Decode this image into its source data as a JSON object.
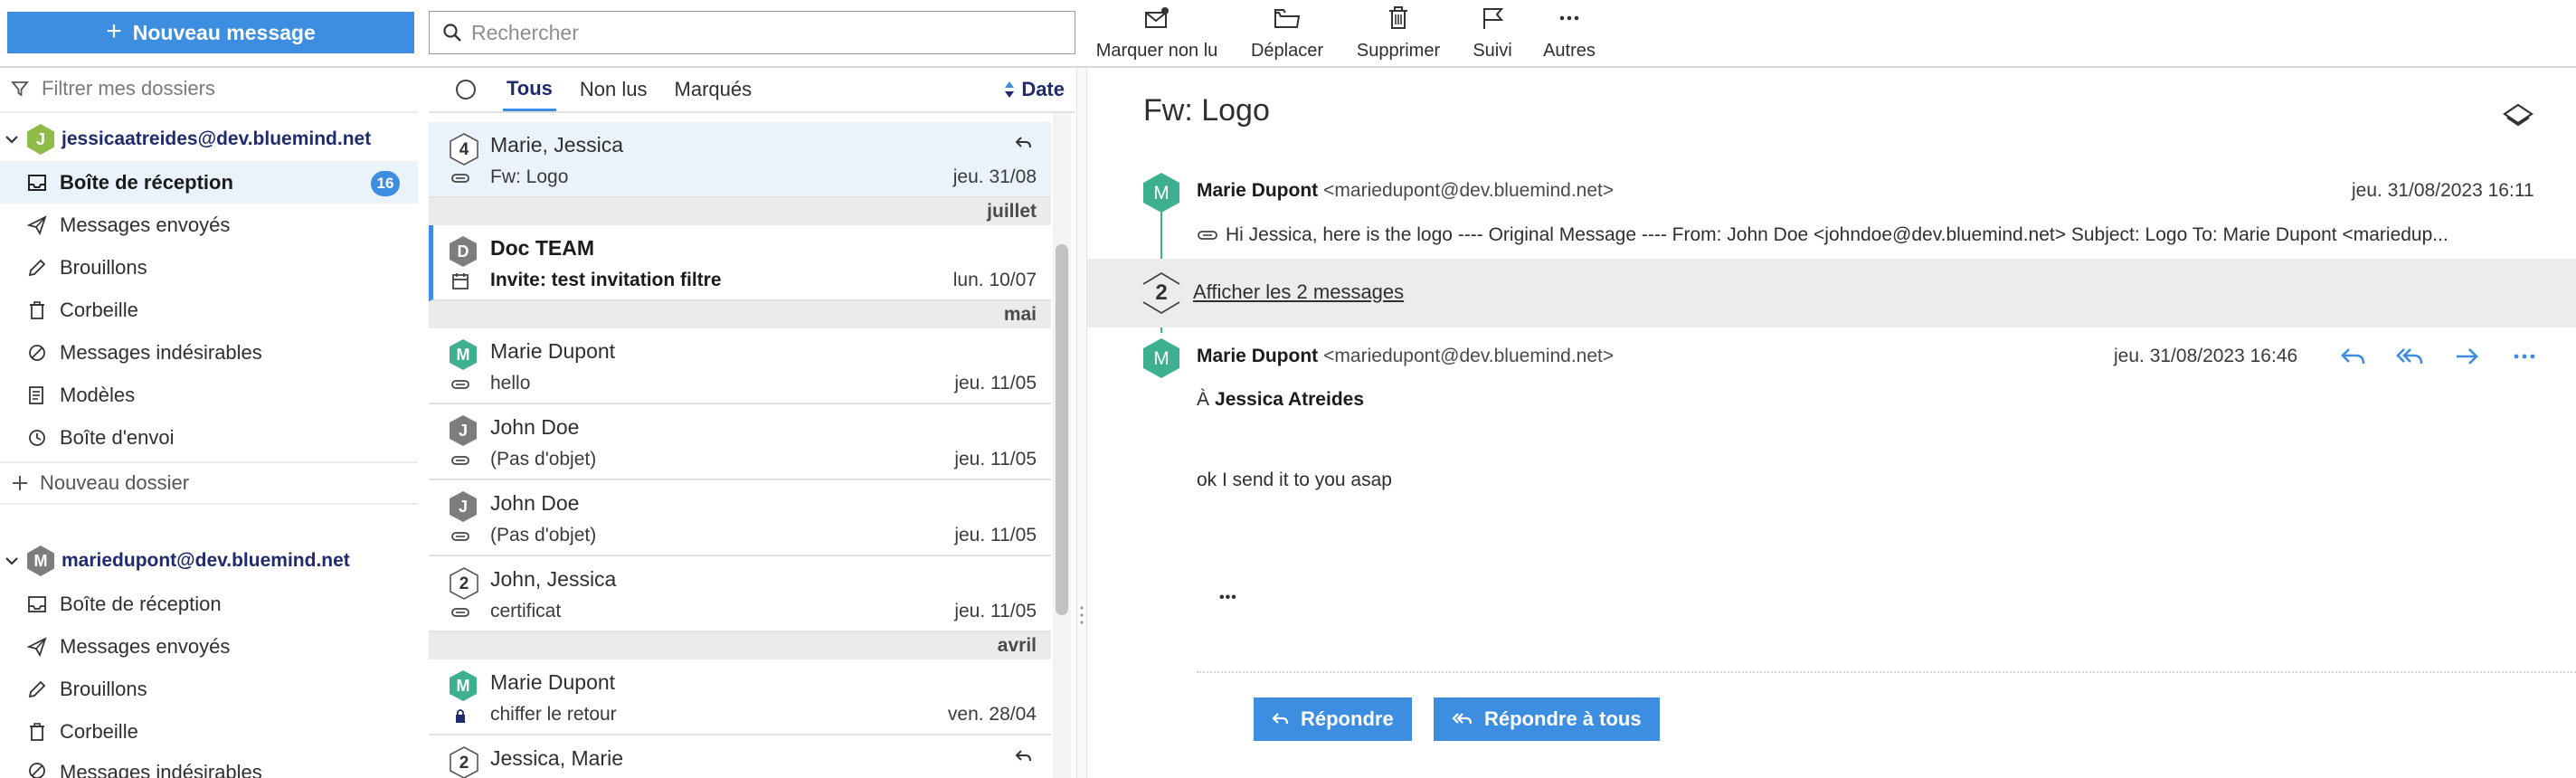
{
  "toolbar": {
    "new_message": "Nouveau message",
    "search_placeholder": "Rechercher",
    "actions": [
      {
        "label": "Marquer non lu",
        "icon": "mark-unread-icon"
      },
      {
        "label": "Déplacer",
        "icon": "folder-move-icon"
      },
      {
        "label": "Supprimer",
        "icon": "trash-icon"
      },
      {
        "label": "Suivi",
        "icon": "flag-icon"
      },
      {
        "label": "Autres",
        "icon": "more-icon"
      }
    ]
  },
  "sidebar": {
    "filter_placeholder": "Filtrer mes dossiers",
    "accounts": [
      {
        "initial": "J",
        "email": "jessicaatreides@dev.bluemind.net",
        "avatar_color": "#8fbb4a",
        "folders": [
          {
            "label": "Boîte de réception",
            "icon": "inbox-icon",
            "badge": "16"
          },
          {
            "label": "Messages envoyés",
            "icon": "send-icon"
          },
          {
            "label": "Brouillons",
            "icon": "pencil-icon"
          },
          {
            "label": "Corbeille",
            "icon": "trash-icon"
          },
          {
            "label": "Messages indésirables",
            "icon": "ban-icon"
          },
          {
            "label": "Modèles",
            "icon": "template-icon"
          },
          {
            "label": "Boîte d'envoi",
            "icon": "clock-icon"
          }
        ]
      },
      {
        "initial": "M",
        "email": "mariedupont@dev.bluemind.net",
        "avatar_color": "#7d7d7d",
        "folders": [
          {
            "label": "Boîte de réception",
            "icon": "inbox-icon"
          },
          {
            "label": "Messages envoyés",
            "icon": "send-icon"
          },
          {
            "label": "Brouillons",
            "icon": "pencil-icon"
          },
          {
            "label": "Corbeille",
            "icon": "trash-icon"
          },
          {
            "label": "Messages indésirables",
            "icon": "ban-icon"
          }
        ]
      }
    ],
    "new_folder": "Nouveau dossier"
  },
  "list": {
    "tabs": [
      "Tous",
      "Non lus",
      "Marqués"
    ],
    "sort_label": "Date",
    "separators": [
      "juillet",
      "mai",
      "avril"
    ],
    "rows": [
      {
        "avatar": "4",
        "from": "Marie, Jessica",
        "subject": "Fw: Logo",
        "date": "jeu. 31/08"
      },
      {
        "avatar": "D",
        "from": "Doc TEAM",
        "subject": "Invite: test invitation filtre",
        "date": "lun. 10/07"
      },
      {
        "avatar": "M",
        "from": "Marie Dupont",
        "subject": "hello",
        "date": "jeu. 11/05"
      },
      {
        "avatar": "J",
        "from": "John Doe",
        "subject": "(Pas d'objet)",
        "date": "jeu. 11/05"
      },
      {
        "avatar": "J",
        "from": "John Doe",
        "subject": "(Pas d'objet)",
        "date": "jeu. 11/05"
      },
      {
        "avatar": "2",
        "from": "John, Jessica",
        "subject": "certificat",
        "date": "jeu. 11/05"
      },
      {
        "avatar": "M",
        "from": "Marie Dupont",
        "subject": "chiffer le retour",
        "date": "ven. 28/04"
      },
      {
        "avatar": "2",
        "from": "Jessica, Marie",
        "subject": "",
        "date": ""
      }
    ]
  },
  "conversation": {
    "title": "Fw: Logo",
    "first": {
      "avatar": "M",
      "name": "Marie Dupont",
      "email": "<mariedupont@dev.bluemind.net>",
      "date": "jeu. 31/08/2023 16:11",
      "preview": "Hi Jessica, here is the logo ---- Original Message ---- From: John Doe <johndoe@dev.bluemind.net> Subject: Logo To: Marie Dupont <mariedup..."
    },
    "collapsed_count": "2",
    "collapsed_label": "Afficher les 2 messages",
    "last": {
      "avatar": "M",
      "name": "Marie Dupont",
      "email": "<mariedupont@dev.bluemind.net>",
      "date": "jeu. 31/08/2023 16:46",
      "to_prefix": "À",
      "to_name": "Jessica Atreides",
      "body": "ok I send it to you asap",
      "ellipsis": "•••"
    },
    "reply": "Répondre",
    "reply_all": "Répondre à tous"
  },
  "colors": {
    "accent": "#3d8ee0",
    "teal": "#3fb08f",
    "navy": "#1f2b6e"
  }
}
